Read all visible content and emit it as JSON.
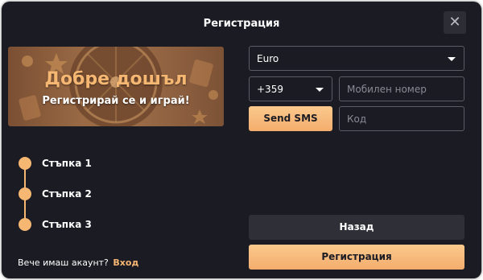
{
  "modal": {
    "title": "Регистрация",
    "close_icon": "close-icon"
  },
  "banner": {
    "title": "Добре дошъл",
    "subtitle": "Регистрирай се и играй!"
  },
  "steps": [
    {
      "label": "Стъпка 1"
    },
    {
      "label": "Стъпка 2"
    },
    {
      "label": "Стъпка 3"
    }
  ],
  "login": {
    "prompt": "Вече имаш акаунт?",
    "link": "Вход"
  },
  "form": {
    "currency": {
      "value": "Euro"
    },
    "phone_code": {
      "value": "+359"
    },
    "mobile": {
      "placeholder": "Мобилен номер"
    },
    "send_sms_label": "Send SMS",
    "code": {
      "placeholder": "Код"
    }
  },
  "buttons": {
    "back_label": "Назад",
    "register_label": "Регистрация"
  },
  "colors": {
    "accent": "#f6b772",
    "background": "#1b1b23",
    "button_dark": "#2f2f38"
  }
}
